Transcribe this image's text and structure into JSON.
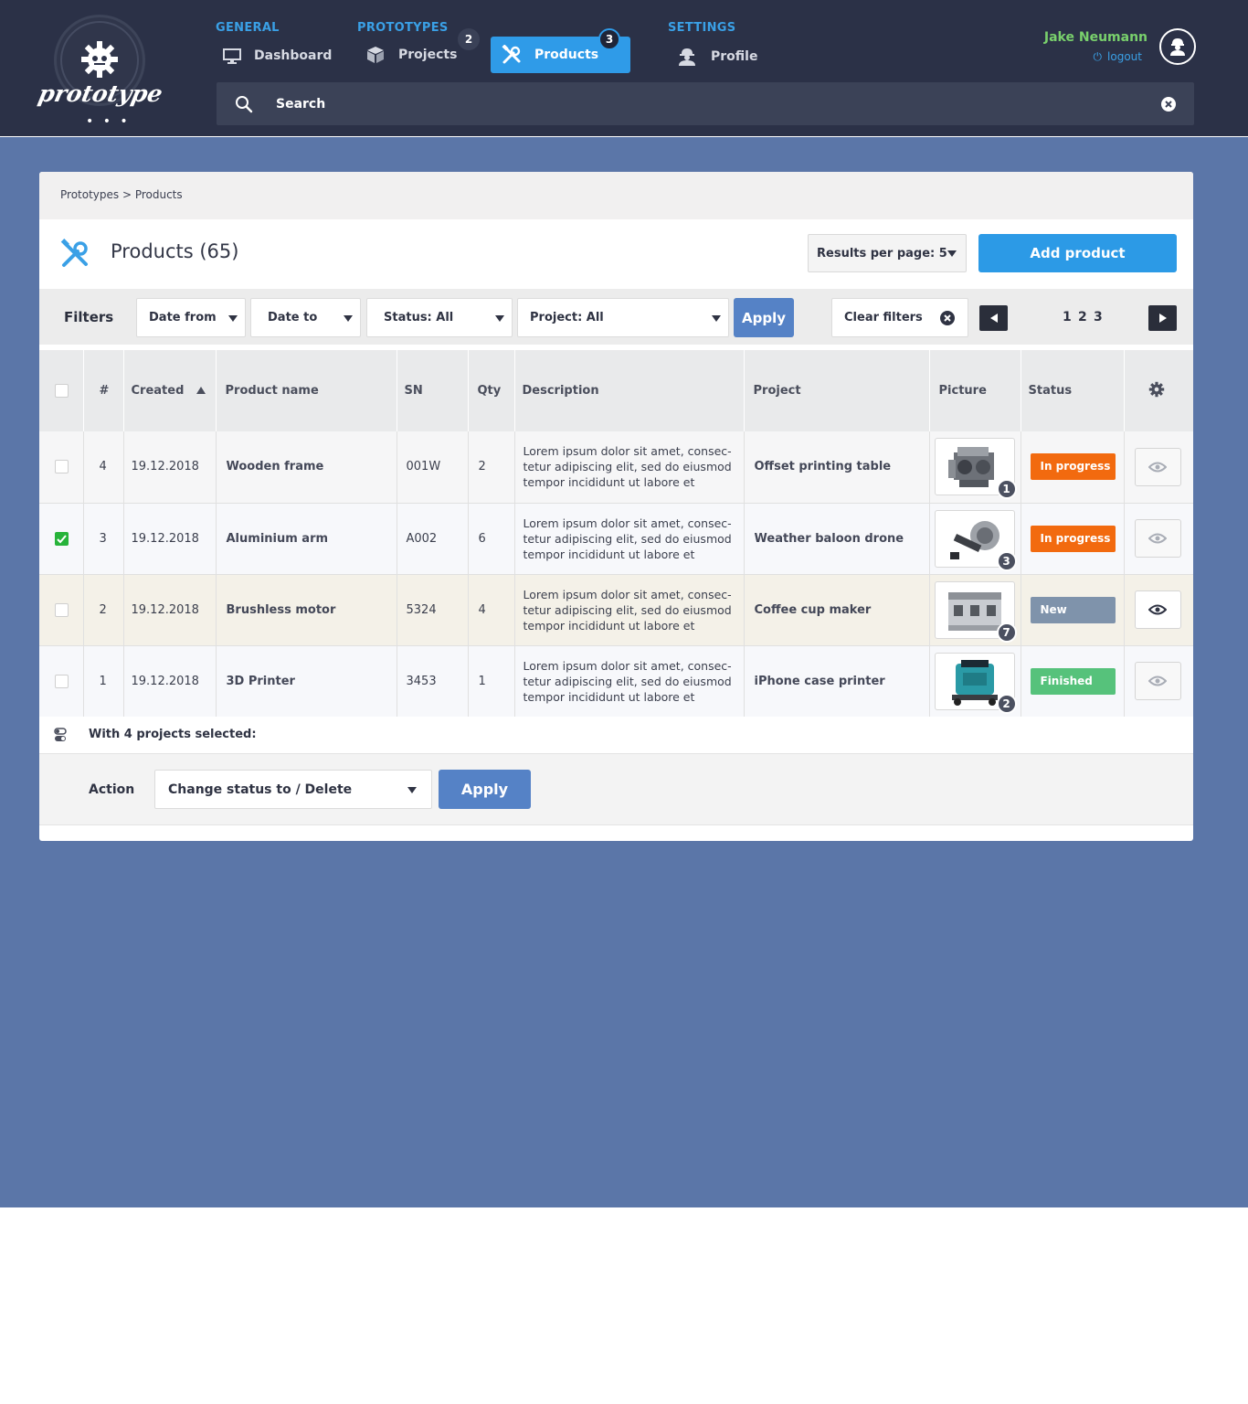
{
  "app": {
    "logo_text": "prototype",
    "logo_dots": "• • •"
  },
  "nav": {
    "groups": [
      {
        "label": "GENERAL"
      },
      {
        "label": "PROTOTYPES"
      },
      {
        "label": "SETTINGS"
      }
    ],
    "items": [
      {
        "label": "Dashboard",
        "icon": "monitor-icon"
      },
      {
        "label": "Projects",
        "icon": "box-icon",
        "badge": "2"
      },
      {
        "label": "Products",
        "icon": "tools-icon",
        "badge": "3",
        "active": true
      },
      {
        "label": "Profile",
        "icon": "worker-icon"
      }
    ]
  },
  "user": {
    "name": "Jake Neumann",
    "logout": "logout"
  },
  "search": {
    "placeholder": "Search"
  },
  "breadcrumb": "Prototypes > Products",
  "page": {
    "title": "Products (65)",
    "results_per_page": "Results per page: 5",
    "add_button": "Add product"
  },
  "filters": {
    "label": "Filters",
    "date_from": "Date from",
    "date_to": "Date to",
    "status": "Status: All",
    "project": "Project: All",
    "apply": "Apply",
    "clear": "Clear filters",
    "pages": [
      "1",
      "2",
      "3"
    ]
  },
  "table": {
    "columns": [
      "#",
      "Created",
      "Product name",
      "SN",
      "Qty",
      "Description",
      "Project",
      "Picture",
      "Status"
    ],
    "rows": [
      {
        "id": "4",
        "created": "19.12.2018",
        "name": "Wooden frame",
        "sn": "001W",
        "qty": "2",
        "description": "Lorem ipsum dolor sit amet, consec-tetur adipiscing elit, sed do eiusmod tempor incididunt ut labore et",
        "project": "Offset printing table",
        "picture_count": "1",
        "status": "In progress",
        "checked": false
      },
      {
        "id": "3",
        "created": "19.12.2018",
        "name": "Aluminium arm",
        "sn": "A002",
        "qty": "6",
        "description": "Lorem ipsum dolor sit amet, consec-tetur adipiscing elit, sed do eiusmod tempor incididunt ut labore et",
        "project": "Weather baloon drone",
        "picture_count": "3",
        "status": "In progress",
        "checked": true
      },
      {
        "id": "2",
        "created": "19.12.2018",
        "name": "Brushless motor",
        "sn": "5324",
        "qty": "4",
        "description": "Lorem ipsum dolor sit amet, consec-tetur adipiscing elit, sed do eiusmod tempor incididunt ut labore et",
        "project": "Coffee cup maker",
        "picture_count": "7",
        "status": "New",
        "checked": false
      },
      {
        "id": "1",
        "created": "19.12.2018",
        "name": "3D Printer",
        "sn": "3453",
        "qty": "1",
        "description": "Lorem ipsum dolor sit amet, consec-tetur adipiscing elit, sed do eiusmod tempor incididunt ut labore et",
        "project": "iPhone case printer",
        "picture_count": "2",
        "status": "Finished",
        "checked": false
      }
    ]
  },
  "bulk": {
    "text": "With 4 projects selected:",
    "action_label": "Action",
    "action_select": "Change status to / Delete",
    "apply": "Apply"
  },
  "colors": {
    "header_bg": "#2b3147",
    "page_bg": "#5b76a8",
    "accent": "#2c9ae6",
    "in_progress": "#f26a0f",
    "new": "#7f93ab",
    "finished": "#56c27b",
    "user_name": "#79d06c"
  }
}
